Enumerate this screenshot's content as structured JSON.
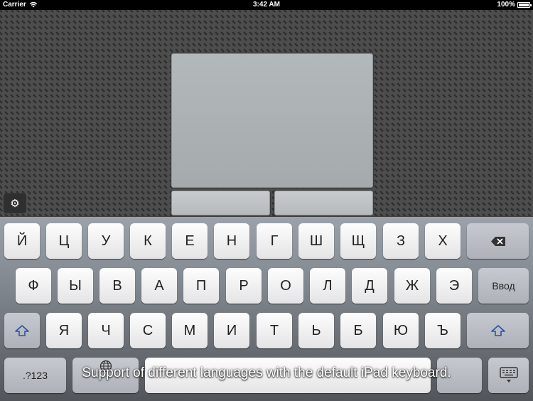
{
  "status_bar": {
    "carrier": "Carrier",
    "time": "3:42 AM",
    "battery": "100%",
    "battery_level": 1.0
  },
  "keyboard": {
    "row1": [
      "Й",
      "Ц",
      "У",
      "К",
      "Е",
      "Н",
      "Г",
      "Ш",
      "Щ",
      "З",
      "Х"
    ],
    "row2": [
      "Ф",
      "Ы",
      "В",
      "А",
      "П",
      "Р",
      "О",
      "Л",
      "Д",
      "Ж",
      "Э"
    ],
    "row2_enter": "Ввод",
    "row3": [
      "Я",
      "Ч",
      "С",
      "М",
      "И",
      "Т",
      "Ь",
      "Б",
      "Ю",
      "Ъ"
    ],
    "row4_numbers": ".?123"
  },
  "caption": "Support of different languages with the default iPad keyboard.",
  "icons": {
    "wifi": "wifi-icon",
    "gear": "gear-icon",
    "backspace": "backspace-icon",
    "shift": "shift-icon",
    "globe": "globe-icon",
    "hide_keyboard": "hide-keyboard-icon"
  },
  "colors": {
    "shift_accent": "#2b4fa8",
    "status_bar": "#000000"
  }
}
